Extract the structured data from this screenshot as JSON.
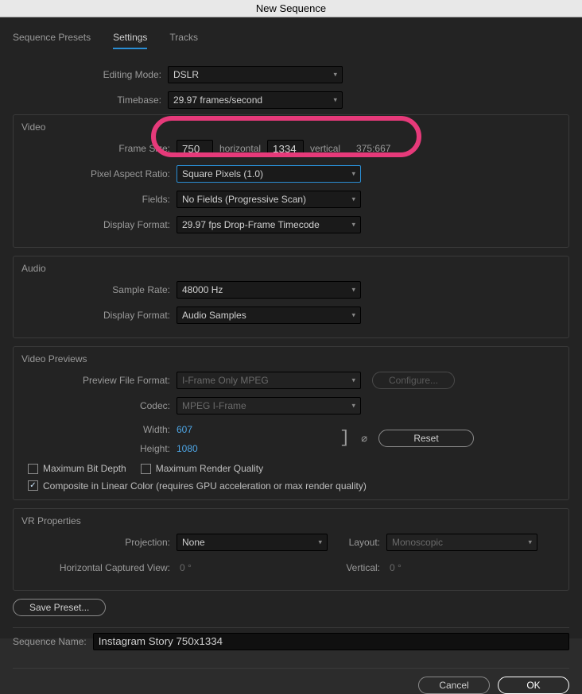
{
  "title": "New Sequence",
  "tabs": {
    "presets": "Sequence Presets",
    "settings": "Settings",
    "tracks": "Tracks"
  },
  "settings": {
    "editingModeLabel": "Editing Mode:",
    "editingMode": "DSLR",
    "timebaseLabel": "Timebase:",
    "timebase": "29.97  frames/second"
  },
  "video": {
    "heading": "Video",
    "frameSizeLabel": "Frame Size:",
    "width": "750",
    "horizontalLabel": "horizontal",
    "height": "1334",
    "verticalLabel": "vertical",
    "aspectRatio": "375:667",
    "pixelAspectLabel": "Pixel Aspect Ratio:",
    "pixelAspect": "Square Pixels (1.0)",
    "fieldsLabel": "Fields:",
    "fields": "No Fields (Progressive Scan)",
    "displayFormatLabel": "Display Format:",
    "displayFormat": "29.97 fps Drop-Frame Timecode"
  },
  "audio": {
    "heading": "Audio",
    "sampleRateLabel": "Sample Rate:",
    "sampleRate": "48000 Hz",
    "displayFormatLabel": "Display Format:",
    "displayFormat": "Audio Samples"
  },
  "previews": {
    "heading": "Video Previews",
    "fileFormatLabel": "Preview File Format:",
    "fileFormat": "I-Frame Only MPEG",
    "configure": "Configure...",
    "codecLabel": "Codec:",
    "codec": "MPEG I-Frame",
    "widthLabel": "Width:",
    "width": "607",
    "heightLabel": "Height:",
    "height": "1080",
    "reset": "Reset",
    "maxBitDepth": "Maximum Bit Depth",
    "maxRenderQuality": "Maximum Render Quality",
    "compositeLinear": "Composite in Linear Color (requires GPU acceleration or max render quality)"
  },
  "vr": {
    "heading": "VR Properties",
    "projectionLabel": "Projection:",
    "projection": "None",
    "layoutLabel": "Layout:",
    "layout": "Monoscopic",
    "hcvLabel": "Horizontal Captured View:",
    "hcv": "0 °",
    "verticalLabel": "Vertical:",
    "vertical": "0 °"
  },
  "savePreset": "Save Preset...",
  "sequenceNameLabel": "Sequence Name:",
  "sequenceName": "Instagram Story 750x1334",
  "buttons": {
    "cancel": "Cancel",
    "ok": "OK"
  }
}
